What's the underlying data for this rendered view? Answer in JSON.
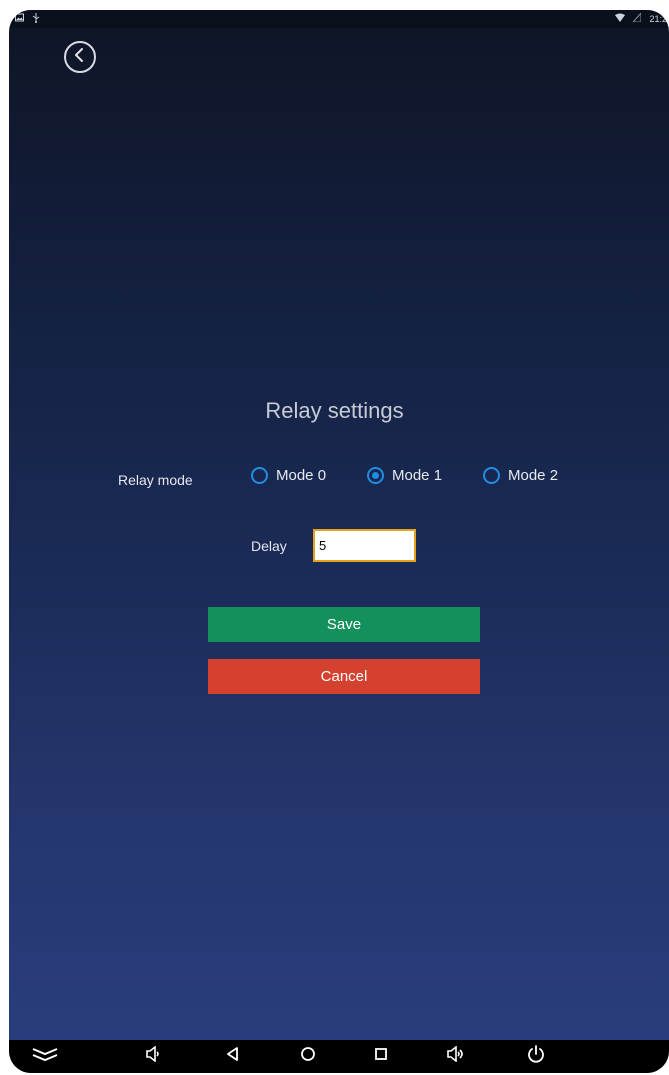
{
  "status_bar": {
    "left_icons": [
      "image-icon",
      "usb-icon"
    ],
    "right_icons": [
      "wifi-icon",
      "signal-icon"
    ],
    "time": "21:2"
  },
  "header": {
    "back_icon": "chevron-left-circle-icon"
  },
  "form": {
    "title": "Relay settings",
    "relay_mode_label": "Relay mode",
    "modes": [
      {
        "label": "Mode 0",
        "checked": false
      },
      {
        "label": "Mode 1",
        "checked": true
      },
      {
        "label": "Mode 2",
        "checked": false
      }
    ],
    "delay_label": "Delay",
    "delay_value": "5",
    "save_label": "Save",
    "cancel_label": "Cancel"
  },
  "nav_bar": {
    "items": [
      "collapse-icon",
      "volume-down-icon",
      "back-icon",
      "home-icon",
      "recents-icon",
      "volume-up-icon",
      "power-icon"
    ]
  },
  "colors": {
    "accent": "#1f8de3",
    "save": "#14905a",
    "cancel": "#d5412f",
    "input_border": "#e6a21d"
  }
}
